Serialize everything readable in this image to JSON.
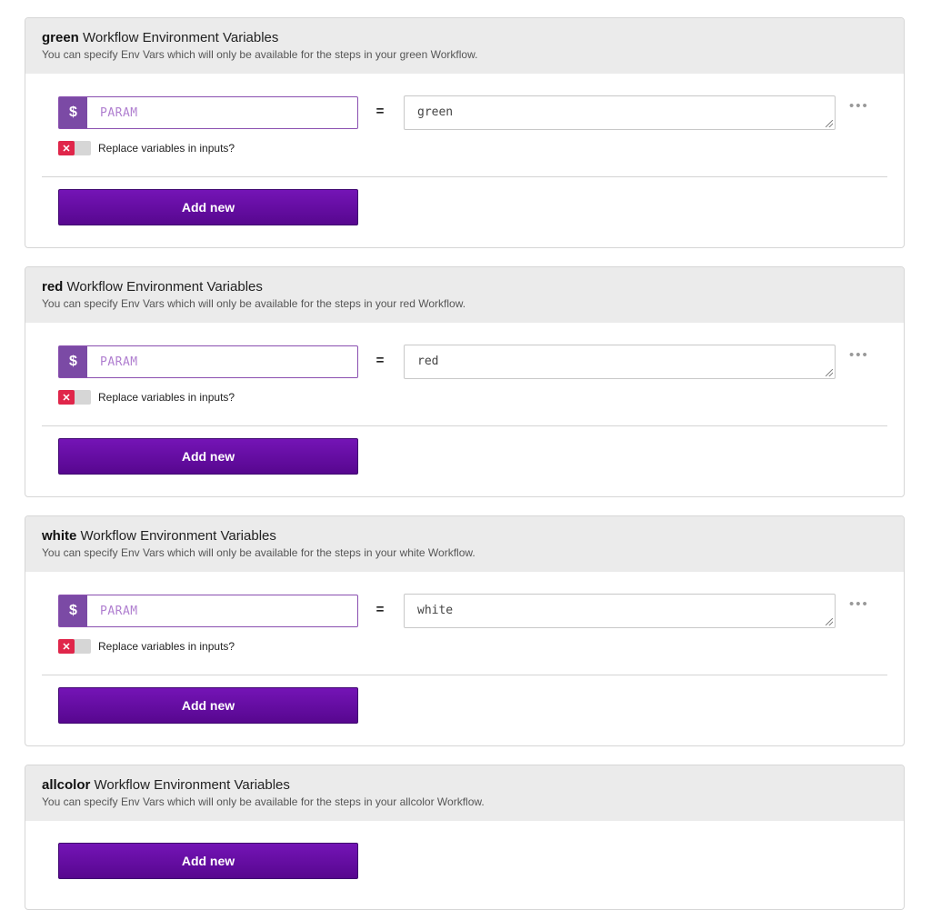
{
  "title_suffix": "Workflow Environment Variables",
  "subtitle_prefix": "You can specify Env Vars which will only be available for the steps in your",
  "subtitle_suffix": "Workflow.",
  "key_placeholder": "PARAM",
  "dollar_symbol": "$",
  "equals_symbol": "=",
  "more_symbol": "•••",
  "replace_label": "Replace variables in inputs?",
  "toggle_off_symbol": "✕",
  "add_label": "Add new",
  "panels": [
    {
      "name": "green",
      "value": "green"
    },
    {
      "name": "red",
      "value": "red"
    },
    {
      "name": "white",
      "value": "white"
    },
    {
      "name": "allcolor"
    }
  ],
  "colors": {
    "accent": "#6a0dad",
    "toggle_off": "#e0264a",
    "header_bg": "#ebebeb"
  }
}
